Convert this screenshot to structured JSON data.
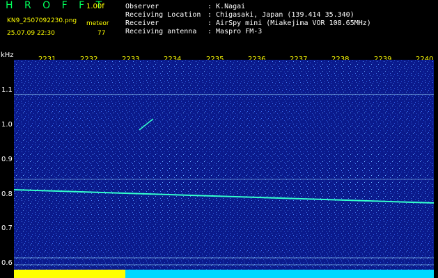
{
  "app_title": "H R O F F T",
  "version": "1.00f",
  "filename": "KN9_2507092230.png",
  "datetime": "25.07.09 22:30",
  "count_label": "meteor",
  "count_value": "77",
  "info": [
    {
      "label": "Observer",
      "value": ": K.Nagai"
    },
    {
      "label": "Receiving Location",
      "value": ": Chigasaki, Japan (139.414 35.340)"
    },
    {
      "label": "Receiver",
      "value": ": AirSpy mini (Miakejima VOR 108.65MHz)"
    },
    {
      "label": "Receiving antenna",
      "value": ": Maspro FM-3"
    }
  ],
  "y_axis": {
    "unit": "kHz",
    "ticks": [
      "1.1",
      "1.0",
      "0.9",
      "0.8",
      "0.7",
      "0.6"
    ]
  },
  "x_axis": {
    "ticks": [
      "2231",
      "2232",
      "2233",
      "2234",
      "2235",
      "2236",
      "2237",
      "2238",
      "2239",
      "2240"
    ]
  },
  "colors": {
    "background": "#000000",
    "plot": "#0a1a8c",
    "title": "#00ff5a",
    "label": "#ffff00",
    "trace": "#33ffcc"
  }
}
